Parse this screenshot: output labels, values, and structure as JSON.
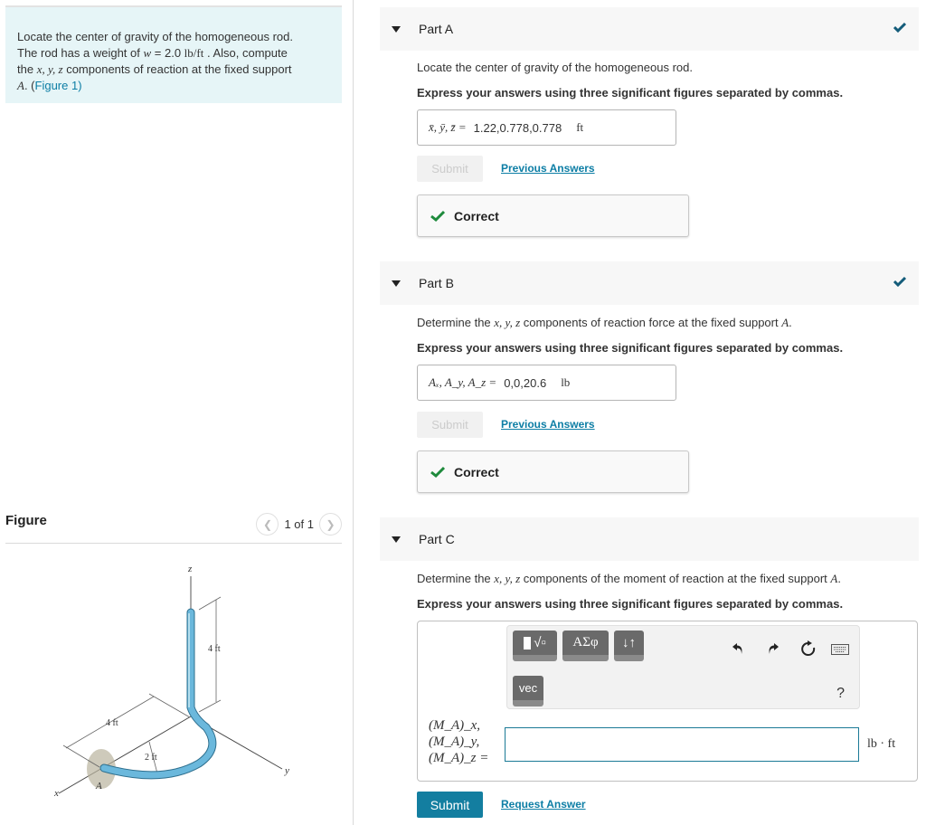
{
  "intro": {
    "line1": "Locate the center of gravity of the homogeneous rod.",
    "line2_pre": "The rod has a weight of ",
    "w_var": "w",
    "w_eq": " = 2.0 ",
    "w_unit": "lb/ft",
    "line2_post": " . Also, compute",
    "line3_pre": "the ",
    "vars": "x, y, z",
    "line3_post": " components of reaction at the fixed support",
    "point": "A",
    "period": ". (",
    "figure_link": "Figure 1",
    "close": ")"
  },
  "figure": {
    "title": "Figure",
    "pager": "1 of 1",
    "prev_icon": "chevron-left-icon",
    "next_icon": "chevron-right-icon",
    "labels": {
      "z": "z",
      "x": "x",
      "y": "y",
      "A": "A",
      "dim_vertical": "4 ft",
      "dim_horizontal": "4 ft",
      "dim_radius": "2 ft"
    }
  },
  "partA": {
    "title": "Part A",
    "status": "complete",
    "question": "Locate the center of gravity of the homogeneous rod.",
    "instruction": "Express your answers using three significant figures separated by commas.",
    "answer_label": "x̄, ȳ, z̄ =",
    "answer_value": "1.22,0.778,0.778",
    "answer_unit": "ft",
    "submit_label": "Submit",
    "prev_label": "Previous Answers",
    "feedback": "Correct"
  },
  "partB": {
    "title": "Part B",
    "status": "complete",
    "question_pre": "Determine the ",
    "question_vars": "x, y, z",
    "question_post": " components of reaction force at the fixed support ",
    "question_point": "A",
    "instruction": "Express your answers using three significant figures separated by commas.",
    "answer_label": "Aₓ, A_y, A_z =",
    "answer_value": "0,0,20.6",
    "answer_unit": "lb",
    "submit_label": "Submit",
    "prev_label": "Previous Answers",
    "feedback": "Correct"
  },
  "partC": {
    "title": "Part C",
    "question_pre": "Determine the ",
    "question_vars": "x, y, z",
    "question_post": " components of the moment of reaction at the fixed support ",
    "question_point": "A",
    "instruction": "Express your answers using three significant figures separated by commas.",
    "toolbar": {
      "templates_label": "√▫",
      "greek_label": "ΑΣφ",
      "arrows_label": "↓↑",
      "vec_label": "vec",
      "help_label": "?"
    },
    "labels": [
      "(M_A)_x,",
      "(M_A)_y,",
      "(M_A)_z ="
    ],
    "answer_value": "",
    "answer_unit": "lb · ft",
    "submit_label": "Submit",
    "request_label": "Request Answer"
  },
  "colors": {
    "accent": "#137ea0",
    "link": "#0d7ea5",
    "check_header": "#145c7a",
    "check_correct": "#1e8a3c",
    "intro_bg": "#e6f5f7",
    "rod": "#6bb8dc"
  }
}
